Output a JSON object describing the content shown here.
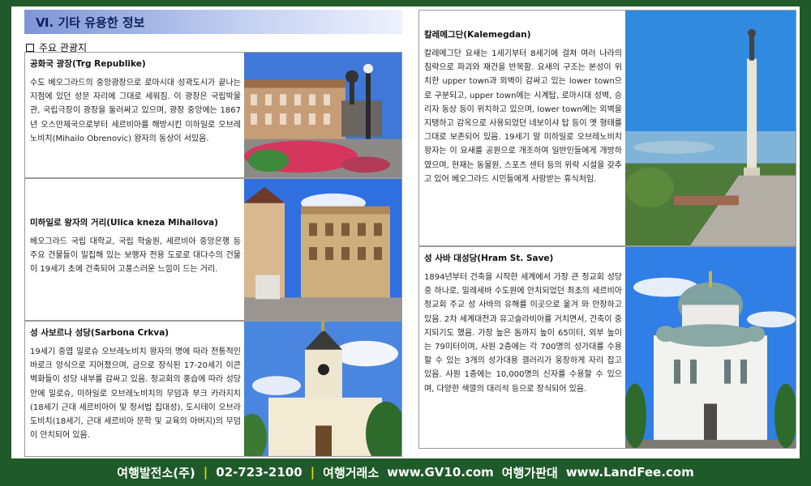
{
  "section": {
    "number": "Ⅵ.",
    "title": "기타 유용한 정보",
    "subheading": "주요 관광지"
  },
  "cards": [
    {
      "title": "공화국 광장(Trg Republike)",
      "body": "수도 베오그라드의 중앙광장으로 로마시대 성곽도시가 끝나는 지점에 있던 성문 자리에 그대로 세워짐. 이 광장은 국립박물관, 국립극장이 광장을 둘러싸고 있으며, 광장 중앙에는 1867년 오스만제국으로부터 세르비아를 해방시킨 미하일로 오브레노비치(Mihailo Obrenovic) 왕자의 동상이 서있음."
    },
    {
      "title": "미하일로 왕자의 거리(Ulica kneza Mihailova)",
      "body": "베오그라드 국립 대학교, 국립 학술원, 세르비아 중앙은행 등 주요 건물들이 밀집해 있는 보행자 전용 도로로 대다수의 건물이 19세기 초에 건축되어 고풍스러운 느낌이 드는 거리."
    },
    {
      "title": "성 사보르나 성당(Sarbona Crkva)",
      "body": "19세기 중엽 밀로슈 오브레노비치 왕자의 명에 따라 전통적인 바로크 양식으로 지어졌으며, 금으로 장식된 17-20세기 이콘 벽화들이 성당 내부를 감싸고 있음. 정교회의 풍습에 따라 성당 안에 밀로슈, 미하일로 오브레노비치의 무덤과 부크 카라지치(18세기 근대 세르비아어 및 정서법 집대성), 도시테이 오브라도비치(18세기, 근대 세르비아 문학 및 교육의 아버지)의 무덤이 안치되어 있음."
    },
    {
      "title": "칼레메그단(Kalemegdan)",
      "body": "칼레메그단 요새는 1세기부터 8세기에 걸쳐 여러 나라의 침략으로 파괴와 재건을 반복함. 요새의 구조는 본성이 위치한 upper town과 외벽이 감싸고 있는 lower town으로 구분되고, upper town에는 시계탑, 로마시대 성벽, 승리자 동상 등이 위치하고 있으며, lower town에는 외벽을 지탱하고 감옥으로 사용되었던 네보이샤 탑 등이 옛 형태를 그대로 보존되어 있음. 19세기 말 미하일로 오브레노비치 왕자는 이 요새를 공원으로 개조하여 일반인들에게 개방하였으며, 현재는 동물원, 스포츠 센터 등의 위락 시설을 갖추고 있어 베오그라드 시민들에게 사랑받는 휴식처임."
    },
    {
      "title": "성 사바 대성당(Hram St. Save)",
      "body": "1894년부터 건축을 시작한 세계에서 가장 큰 정교회 성당 중 하나로, 밀레세바 수도원에 안치되었던 최초의 세르비아 정교회 주교 성 사바의 유해를 이곳으로 옮겨 와 안장하고 있음. 2차 세계대전과 유고슬라비아를 거치면서, 건축이 중지되기도 했음. 가장 높은 돔까지 높이 65미터, 외부 높이는 79미터이며, 사원 2층에는 각 700명의 성가대를 수용할 수 있는 3개의 성가대용 갤러리가 웅장하게 자리 잡고 있음. 사원 1층에는 10,000명의 신자를 수용할 수 있으며, 다양한 색깔의 대리석 등으로 장식되어 있음."
    }
  ],
  "footer": {
    "company": "여행발전소(주)",
    "sep1": "|",
    "phone": "02-723-2100",
    "sep2": "|",
    "label1": "여행거래소",
    "url1": "www.GV10.com",
    "label2": "여행가판대",
    "url2": "www.LandFee.com"
  },
  "colors": {
    "frame": "#1f5a2a",
    "header_band": "#7e95d6",
    "separator": "#f0d000"
  }
}
